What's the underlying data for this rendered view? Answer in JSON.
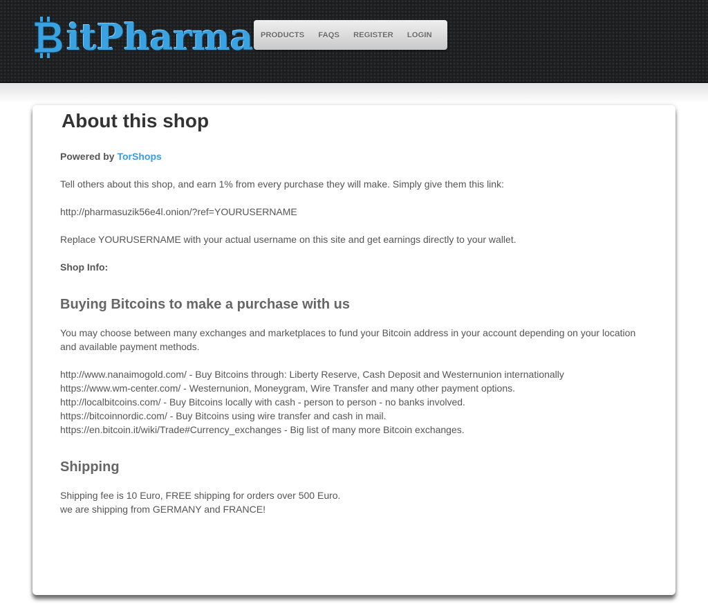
{
  "brand": {
    "name": "BitPharma",
    "logo_letter": "B",
    "logo_rest": "itPharma"
  },
  "nav": {
    "items": [
      "PRODUCTS",
      "FAQS",
      "REGISTER",
      "LOGIN"
    ]
  },
  "page": {
    "title": "About this shop",
    "powered_prefix": "Powered by",
    "powered_link": "TorShops",
    "referral_intro": "Tell others about this shop, and earn 1% from every purchase they will make. Simply give them this link:",
    "referral_link": "http://pharmasuzik56e4l.onion/?ref=YOURUSERNAME",
    "referral_note": "Replace YOURUSERNAME with your actual username on this site and get earnings directly to your wallet.",
    "shop_info_label": "Shop Info:"
  },
  "bitcoins": {
    "heading": "Buying Bitcoins to make a purchase with us",
    "intro_line1": "You may choose between many exchanges and marketplaces to fund your Bitcoin address in your account depending on your location",
    "intro_line2": "and available payment methods.",
    "exchanges": [
      "http://www.nanaimogold.com/ - Buy Bitcoins through: Liberty Reserve, Cash Deposit and Westernunion internationally",
      "https://www.wm-center.com/ - Westernunion, Moneygram, Wire Transfer and many other payment options.",
      "http://localbitcoins.com/ - Buy Bitcoins locally with cash - person to person - no banks involved.",
      "https://bitcoinnordic.com/ - Buy Bitcoins using wire transfer and cash in mail.",
      "https://en.bitcoin.it/wiki/Trade#Currency_exchanges - Big list of many more Bitcoin exchanges."
    ]
  },
  "shipping": {
    "heading": "Shipping",
    "line1": "Shipping fee is 10 Euro, FREE shipping for orders over 500 Euro.",
    "line2": "we are shipping from GERMANY and FRANCE!"
  },
  "colors": {
    "header_bg": "#1c1d1f",
    "brand_blue": "#3aa2e0",
    "link_blue": "#3a9be0",
    "text_gray": "#555555"
  }
}
